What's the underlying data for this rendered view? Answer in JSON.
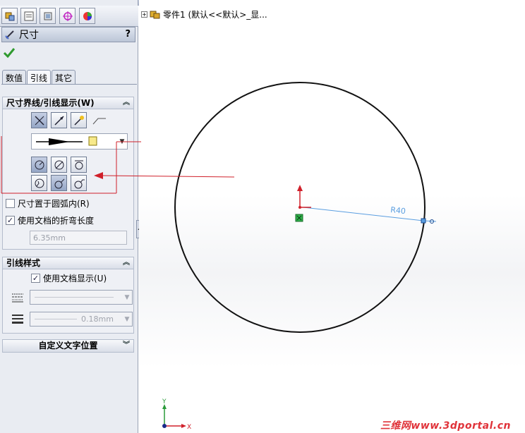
{
  "tree": {
    "expand": "+",
    "item": "零件1  (默认<<默认>_显..."
  },
  "panel": {
    "title": "尺寸",
    "help": "?",
    "tabs": [
      "数值",
      "引线",
      "其它"
    ],
    "groups": {
      "witness": {
        "title": "尺寸界线/引线显示(W)"
      },
      "checks": {
        "arc_inside": "尺寸置于圆弧内(R)",
        "use_doc_bend": "使用文档的折弯长度"
      },
      "bend_length": "6.35mm",
      "leader_style": {
        "title": "引线样式",
        "use_doc_display": "使用文档显示(U)",
        "thickness": "0.18mm"
      },
      "custom_text": {
        "title": "自定义文字位置"
      }
    }
  },
  "canvas": {
    "dimension_label": "R40",
    "axis_y": "Y",
    "axis_x": "X"
  },
  "watermark": "三维网www.3dportal.cn",
  "colors": {
    "annotation": "#d0202a",
    "dimension": "#5a9ee0"
  }
}
